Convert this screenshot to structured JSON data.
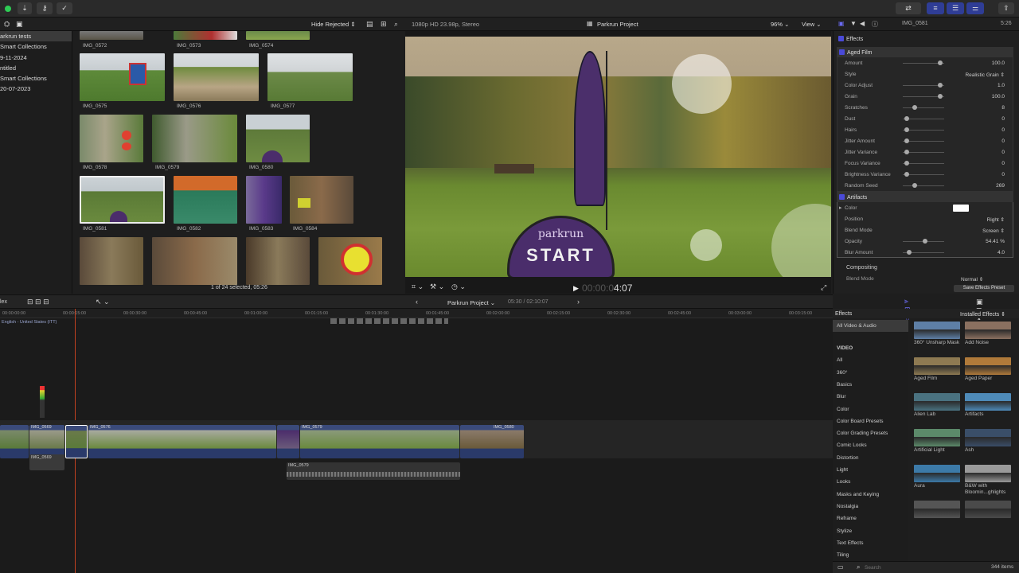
{
  "colors": {
    "accent": "#4a4ad8",
    "selected": "#3b3b3b",
    "bg": "#1e1e1e"
  },
  "topbar": {
    "icons": [
      "download-icon",
      "key-icon",
      "checkmark-icon"
    ],
    "right_icons": [
      "connect-icon",
      "layout-icon",
      "timeline-icon",
      "inspector-icon"
    ]
  },
  "browser_header": {
    "filter": "Hide Rejected",
    "format": "1080p HD 23.98p, Stereo",
    "project": "Parkrun Project",
    "zoom": "96%",
    "view": "View"
  },
  "libraries": [
    {
      "label": "arkrun tests",
      "selected": true
    },
    {
      "label": "Smart Collections",
      "selected": false
    },
    {
      "label": "9-11-2024",
      "selected": false
    },
    {
      "label": "ntitled",
      "selected": false
    },
    {
      "label": "Smart Collections",
      "selected": false
    },
    {
      "label": "20-07-2023",
      "selected": false
    }
  ],
  "clips": [
    {
      "name": "IMG_0572"
    },
    {
      "name": "IMG_0573"
    },
    {
      "name": "IMG_0574"
    },
    {
      "name": "IMG_0575"
    },
    {
      "name": "IMG_0576"
    },
    {
      "name": "IMG_0577"
    },
    {
      "name": "IMG_0578"
    },
    {
      "name": "IMG_0579"
    },
    {
      "name": "IMG_0580"
    },
    {
      "name": "IMG_0581"
    },
    {
      "name": "IMG_0582"
    },
    {
      "name": "IMG_0583"
    },
    {
      "name": "IMG_0584"
    },
    {
      "name": ""
    },
    {
      "name": ""
    },
    {
      "name": ""
    },
    {
      "name": ""
    }
  ],
  "selection_status": "1 of 24 selected, 05:26",
  "viewer": {
    "timecode_dim": "00:00:0",
    "timecode": "4:07",
    "sign_text": "START",
    "logo_text": "parkrun"
  },
  "inspector": {
    "clip_name": "IMG_0581",
    "duration": "5:26",
    "sections": {
      "effects": "Effects",
      "aged_film": "Aged Film",
      "artifacts": "Artifacts",
      "compositing": "Compositing"
    },
    "aged_film_params": [
      {
        "label": "Amount",
        "value": "100.0",
        "level": 0.95
      },
      {
        "label": "Style",
        "value": "Realistic Grain ⇕",
        "level": null
      },
      {
        "label": "Color Adjust",
        "value": "1.0",
        "level": 0.95
      },
      {
        "label": "Grain",
        "value": "100.0",
        "level": 0.95
      },
      {
        "label": "Scratches",
        "value": "8",
        "level": 0.25
      },
      {
        "label": "Dust",
        "value": "0",
        "level": 0.05
      },
      {
        "label": "Hairs",
        "value": "0",
        "level": 0.05
      },
      {
        "label": "Jitter Amount",
        "value": "0",
        "level": 0.05
      },
      {
        "label": "Jitter Variance",
        "value": "0",
        "level": 0.05
      },
      {
        "label": "Focus Variance",
        "value": "0",
        "level": 0.05
      },
      {
        "label": "Brightness Variance",
        "value": "0",
        "level": 0.05
      },
      {
        "label": "Random Seed",
        "value": "269",
        "level": 0.27
      }
    ],
    "artifact_params": [
      {
        "label": "Color",
        "value": "",
        "level": null
      },
      {
        "label": "Position",
        "value": "Right ⇕",
        "level": null
      },
      {
        "label": "Blend Mode",
        "value": "Screen ⇕",
        "level": null
      },
      {
        "label": "Opacity",
        "value": "54.41  %",
        "level": 0.54
      },
      {
        "label": "Blur Amount",
        "value": "4.0",
        "level": 0.1
      }
    ],
    "blend_label": "Blend Mode",
    "blend_value": "Normal ⇕",
    "save_button": "Save Effects Preset"
  },
  "timeline_bar": {
    "index": "lex",
    "project": "Parkrun Project",
    "timecode": "05:30 / 02:10:07"
  },
  "ruler": [
    "00:00:00:00",
    "00:00:15:00",
    "00:00:30:00",
    "00:00:45:00",
    "00:01:00:00",
    "00:01:15:00",
    "00:01:30:00",
    "00:01:45:00",
    "00:02:00:00",
    "00:02:15:00",
    "00:02:30:00",
    "00:02:45:00",
    "00:03:00:00",
    "00:03:15:00"
  ],
  "caption_role": "English - United States (ITT)",
  "timeline_clips": [
    "IMG_0569",
    "IMG_0576",
    "IMG_0579",
    "IMG_0580"
  ],
  "timeline_clip_prefixes": [
    "IMG_",
    "IMG_0..."
  ],
  "connected_clips": [
    "IMG_0569",
    "IMG_0579"
  ],
  "effects_browser": {
    "header": "Effects",
    "installed": "Installed Effects ⇕",
    "categories": [
      "All Video & Audio",
      "VIDEO",
      "All",
      "360°",
      "Basics",
      "Blur",
      "Color",
      "Color Board Presets",
      "Color Grading Presets",
      "Comic Looks",
      "Distortion",
      "Light",
      "Looks",
      "Masks and Keying",
      "Nostalgia",
      "Reframe",
      "Stylize",
      "Text Effects",
      "Tiling"
    ],
    "items": [
      {
        "name": "360° Unsharp Mask",
        "color": "#5e7fa6"
      },
      {
        "name": "Add Noise",
        "color": "#8a7060"
      },
      {
        "name": "Aged Film",
        "color": "#8e7a52"
      },
      {
        "name": "Aged Paper",
        "color": "#b07a3a"
      },
      {
        "name": "Alien Lab",
        "color": "#4a7280"
      },
      {
        "name": "Artifacts",
        "color": "#4e8ab8"
      },
      {
        "name": "Artificial Light",
        "color": "#5c8a6a"
      },
      {
        "name": "Ash",
        "color": "#3a4e68"
      },
      {
        "name": "Aura",
        "color": "#3c7aa8"
      },
      {
        "name": "B&W with Bloomin...ghlights",
        "color": "#9a9a9a"
      },
      {
        "name": "",
        "color": "#555"
      },
      {
        "name": "",
        "color": "#4a4a4a"
      }
    ],
    "search_placeholder": "Search",
    "count": "344 items"
  }
}
